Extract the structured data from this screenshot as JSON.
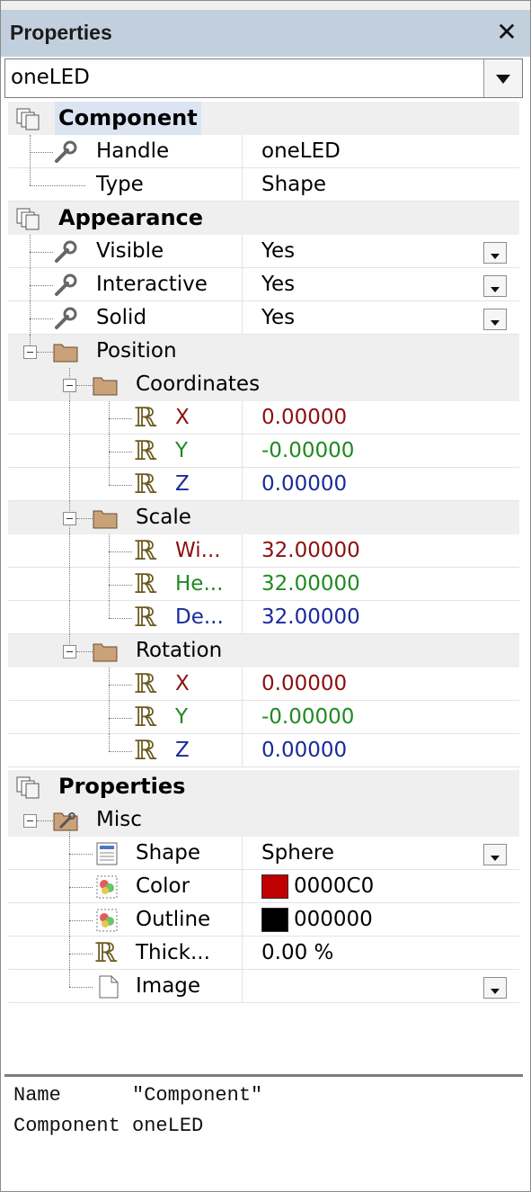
{
  "window": {
    "title": "Properties",
    "close_symbol": "✕"
  },
  "selector": {
    "value": "oneLED"
  },
  "categories": {
    "component": "Component",
    "appearance": "Appearance",
    "properties": "Properties"
  },
  "rows": {
    "handle": {
      "name": "Handle",
      "value": "oneLED"
    },
    "type": {
      "name": "Type",
      "value": "Shape"
    },
    "visible": {
      "name": "Visible",
      "value": "Yes"
    },
    "interactive": {
      "name": "Interactive",
      "value": "Yes"
    },
    "solid": {
      "name": "Solid",
      "value": "Yes"
    },
    "position": {
      "name": "Position"
    },
    "coordinates": {
      "name": "Coordinates"
    },
    "coord_x": {
      "name": "X",
      "value": "0.00000"
    },
    "coord_y": {
      "name": "Y",
      "value": "-0.00000"
    },
    "coord_z": {
      "name": "Z",
      "value": "0.00000"
    },
    "scale": {
      "name": "Scale"
    },
    "scale_w": {
      "name": "Wi...",
      "value": "32.00000"
    },
    "scale_h": {
      "name": "He...",
      "value": "32.00000"
    },
    "scale_d": {
      "name": "De...",
      "value": "32.00000"
    },
    "rotation": {
      "name": "Rotation"
    },
    "rot_x": {
      "name": "X",
      "value": "0.00000"
    },
    "rot_y": {
      "name": "Y",
      "value": "-0.00000"
    },
    "rot_z": {
      "name": "Z",
      "value": "0.00000"
    },
    "misc": {
      "name": "Misc"
    },
    "shape": {
      "name": "Shape",
      "value": "Sphere"
    },
    "color": {
      "name": "Color",
      "value": "0000C0",
      "swatch": "#c00000"
    },
    "outline": {
      "name": "Outline",
      "value": "000000",
      "swatch": "#000000"
    },
    "thickness": {
      "name": "Thick...",
      "value": "0.00 %"
    },
    "image": {
      "name": "Image",
      "value": ""
    }
  },
  "description": {
    "line1": "Name      \"Component\"",
    "line2": "Component oneLED"
  },
  "colors": {
    "titlebar": "#c2cfdc",
    "x_axis": "#8b1010",
    "y_axis": "#1f8a1f",
    "z_axis": "#1a2a9a"
  }
}
